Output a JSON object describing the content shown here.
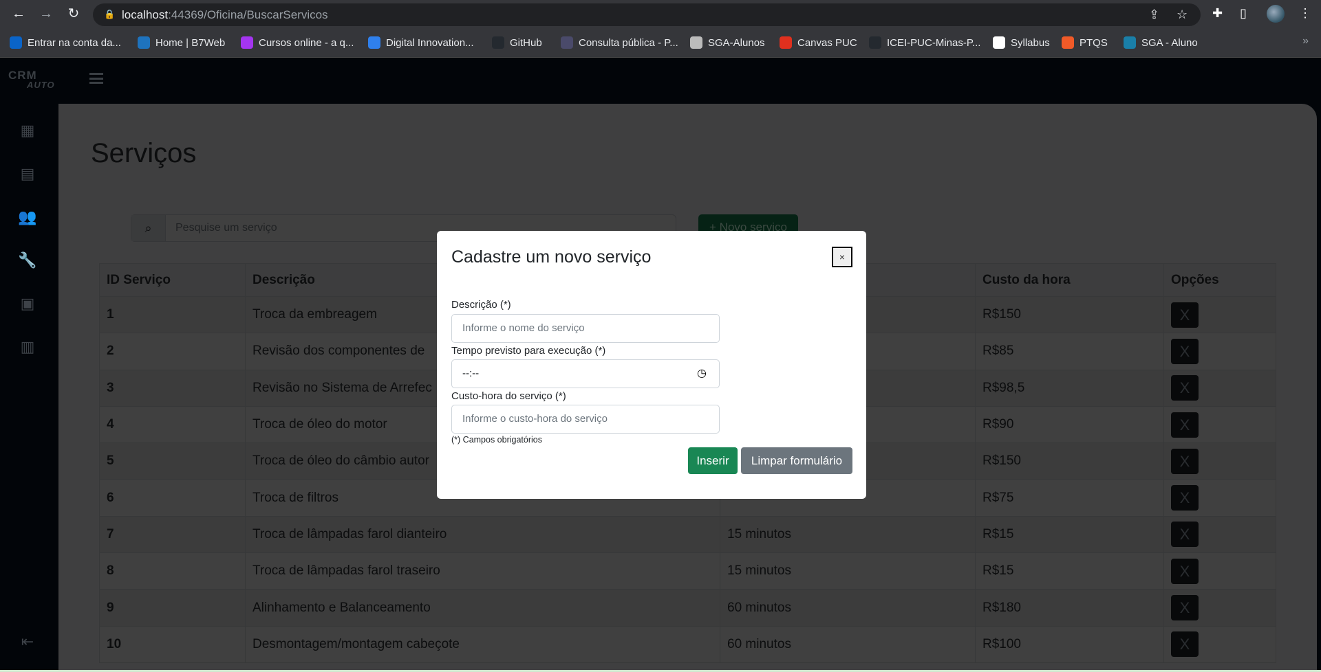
{
  "browser": {
    "url_host": "localhost",
    "url_path": ":44369/Oficina/BuscarServicos",
    "bookmarks": [
      {
        "label": "Entrar na conta da...",
        "icon": "outlook-icon",
        "color": "#0a64c8"
      },
      {
        "label": "Home | B7Web",
        "icon": "b7web-icon",
        "color": "#1e73be"
      },
      {
        "label": "Cursos online - a q...",
        "icon": "udemy-icon",
        "color": "#a435f0"
      },
      {
        "label": "Digital Innovation...",
        "icon": "dio-icon",
        "color": "#2f80ed"
      },
      {
        "label": "GitHub",
        "icon": "github-icon",
        "color": "#24292f"
      },
      {
        "label": "Consulta pública - P...",
        "icon": "pje-icon",
        "color": "#4a4a6a"
      },
      {
        "label": "SGA-Alunos",
        "icon": "sga-icon",
        "color": "#bbbbbb"
      },
      {
        "label": "Canvas PUC",
        "icon": "canvas-icon",
        "color": "#e0301e"
      },
      {
        "label": "ICEI-PUC-Minas-P...",
        "icon": "github-icon",
        "color": "#24292f"
      },
      {
        "label": "Syllabus",
        "icon": "globe-icon",
        "color": "#ffffff"
      },
      {
        "label": "PTQS",
        "icon": "fire-icon",
        "color": "#f05a28"
      },
      {
        "label": "SGA - Aluno",
        "icon": "sga-aluno-icon",
        "color": "#1a7fa8"
      }
    ]
  },
  "app": {
    "logo_top": "CRM",
    "logo_bottom": "AUTO"
  },
  "page": {
    "title": "Serviços",
    "search_placeholder": "Pesquise um serviço",
    "new_button": "+ Novo serviço"
  },
  "table": {
    "headers": [
      "ID Serviço",
      "Descrição",
      "",
      "Custo da hora",
      "Opções"
    ],
    "delete_label": "X",
    "rows": [
      {
        "id": "1",
        "desc": "Troca da embreagem",
        "time": "",
        "cost": "R$150"
      },
      {
        "id": "2",
        "desc": "Revisão dos componentes de",
        "time": "",
        "cost": "R$85"
      },
      {
        "id": "3",
        "desc": "Revisão no Sistema de Arrefec",
        "time": "",
        "cost": "R$98,5"
      },
      {
        "id": "4",
        "desc": "Troca de óleo do motor",
        "time": "",
        "cost": "R$90"
      },
      {
        "id": "5",
        "desc": "Troca de óleo do câmbio autor",
        "time": "",
        "cost": "R$150"
      },
      {
        "id": "6",
        "desc": "Troca de filtros",
        "time": "",
        "cost": "R$75"
      },
      {
        "id": "7",
        "desc": "Troca de lâmpadas farol dianteiro",
        "time": "15 minutos",
        "cost": "R$15"
      },
      {
        "id": "8",
        "desc": "Troca de lâmpadas farol traseiro",
        "time": "15 minutos",
        "cost": "R$15"
      },
      {
        "id": "9",
        "desc": "Alinhamento e Balanceamento",
        "time": "60 minutos",
        "cost": "R$180"
      },
      {
        "id": "10",
        "desc": "Desmontagem/montagem cabeçote",
        "time": "60 minutos",
        "cost": "R$100"
      }
    ]
  },
  "modal": {
    "title": "Cadastre um novo serviço",
    "close": "×",
    "desc_label": "Descrição (*)",
    "desc_placeholder": "Informe o nome do serviço",
    "time_label": "Tempo previsto para execução (*)",
    "time_value": "--:--",
    "cost_label": "Custo-hora do serviço (*)",
    "cost_placeholder": "Informe o custo-hora do serviço",
    "required_note": "(*) Campos obrigatórios",
    "insert": "Inserir",
    "clear": "Limpar formulário",
    "insert_color": "#198754",
    "clear_color": "#6c757d"
  }
}
